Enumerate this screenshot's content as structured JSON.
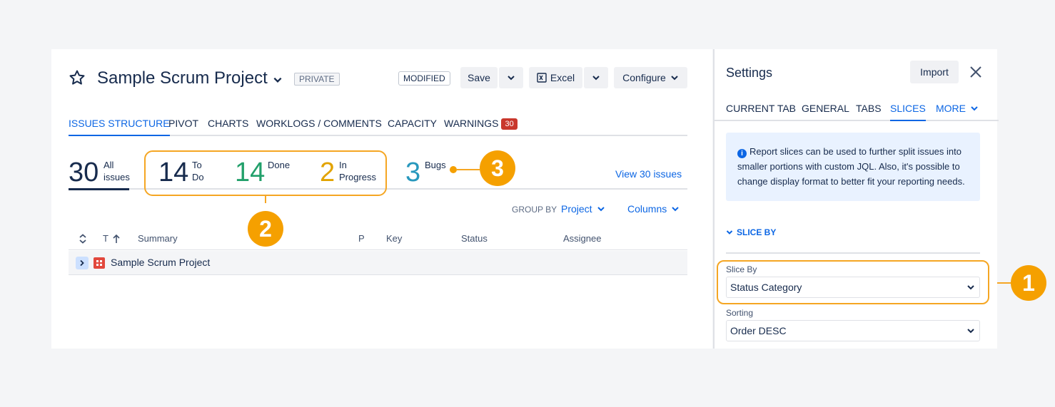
{
  "header": {
    "title": "Sample Scrum Project",
    "private_badge": "PRIVATE",
    "modified_badge": "MODIFIED",
    "save_label": "Save",
    "excel_label": "Excel",
    "configure_label": "Configure"
  },
  "tabs": [
    {
      "label": "ISSUES STRUCTURE",
      "active": true
    },
    {
      "label": "PIVOT"
    },
    {
      "label": "CHARTS"
    },
    {
      "label": "WORKLOGS / COMMENTS"
    },
    {
      "label": "CAPACITY"
    },
    {
      "label": "WARNINGS",
      "count": "30"
    }
  ],
  "stats": {
    "all": {
      "value": "30",
      "label_1": "All",
      "label_2": "issues"
    },
    "todo": {
      "value": "14",
      "label_1": "To",
      "label_2": "Do",
      "color": "#172b4d"
    },
    "done": {
      "value": "14",
      "label_1": "Done",
      "color": "#22a06b"
    },
    "inprogress": {
      "value": "2",
      "label_1": "In",
      "label_2": "Progress",
      "color": "#e2a300"
    },
    "bugs": {
      "value": "3",
      "label_1": "Bugs",
      "color": "#2898bd"
    },
    "view_link": "View 30 issues"
  },
  "toolbar": {
    "group_by_label": "GROUP BY",
    "group_by_value": "Project",
    "columns_label": "Columns"
  },
  "table": {
    "headers": {
      "type": "T",
      "summary": "Summary",
      "priority": "P",
      "key": "Key",
      "status": "Status",
      "assignee": "Assignee"
    },
    "rows": [
      {
        "summary": "Sample Scrum Project"
      }
    ]
  },
  "callouts": [
    "1",
    "2",
    "3"
  ],
  "settings": {
    "title": "Settings",
    "import_label": "Import",
    "tabs": [
      {
        "label": "CURRENT TAB"
      },
      {
        "label": "GENERAL"
      },
      {
        "label": "TABS"
      },
      {
        "label": "SLICES",
        "active": true
      },
      {
        "label": "MORE"
      }
    ],
    "info_text": "Report slices can be used to further split issues into smaller portions with custom JQL. Also, it's possible to change display format to better fit your reporting needs.",
    "section_title": "SLICE BY",
    "slice_by_label": "Slice By",
    "slice_by_value": "Status Category",
    "sorting_label": "Sorting",
    "sorting_value": "Order DESC"
  },
  "colors": {
    "accent": "#0c66e4",
    "callout": "#f5a000",
    "warning": "#c9372c"
  }
}
